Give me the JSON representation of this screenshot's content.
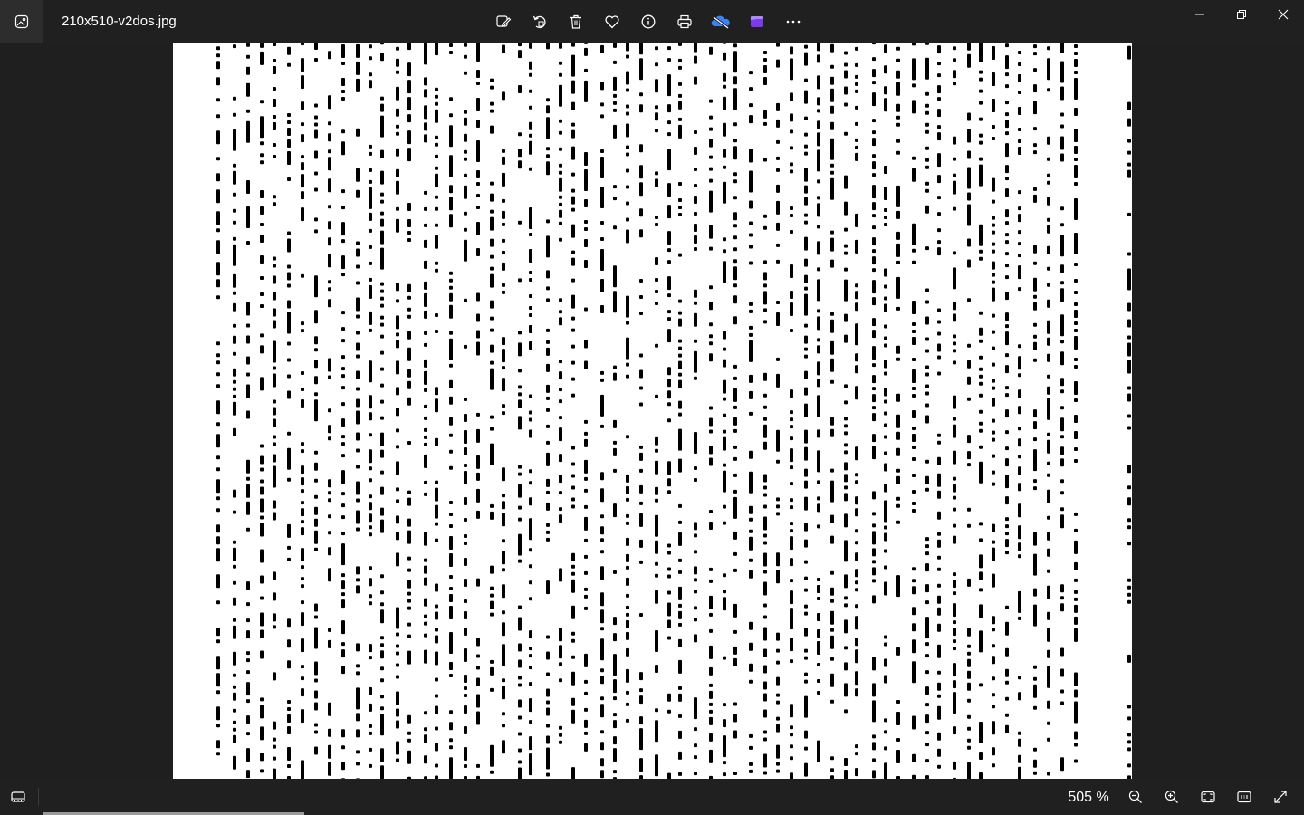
{
  "window": {
    "file_name": "210x510-v2dos.jpg"
  },
  "toolbar": {
    "items": [
      {
        "name": "edit-image-icon",
        "label": "Edit image"
      },
      {
        "name": "rotate-icon",
        "label": "Rotate"
      },
      {
        "name": "delete-icon",
        "label": "Delete"
      },
      {
        "name": "favorite-icon",
        "label": "Favorite"
      },
      {
        "name": "info-icon",
        "label": "File info"
      },
      {
        "name": "print-icon",
        "label": "Print"
      },
      {
        "name": "onedrive-icon",
        "label": "OneDrive"
      },
      {
        "name": "clipchamp-icon",
        "label": "Clipchamp"
      },
      {
        "name": "more-options-icon",
        "label": "See more"
      }
    ]
  },
  "window_controls": {
    "minimize": "minimize-icon",
    "restore": "restore-icon",
    "close": "close-icon"
  },
  "status": {
    "zoom": "505 %",
    "zoom_level": 505
  },
  "colors": {
    "background": "#1f1f1f",
    "titlebar": "#202020",
    "image_bg": "#ffffff",
    "dots": "#000000",
    "onedrive_accent": "#3b82f6",
    "clipchamp_accent": "#7c3aed"
  }
}
